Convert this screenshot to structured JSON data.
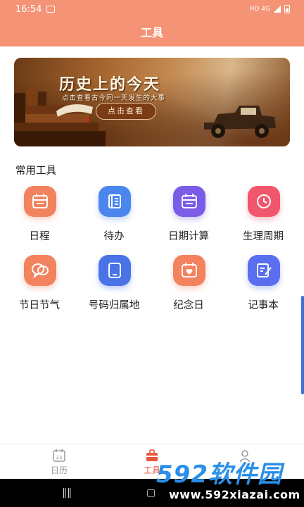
{
  "status_bar": {
    "time": "16:54",
    "network": "HD 4G",
    "signal": "ıll"
  },
  "header": {
    "title": "工具"
  },
  "banner": {
    "title": "历史上的今天",
    "subtitle": "点击查看古今同一天发生的大事",
    "button_label": "点击查看"
  },
  "section": {
    "title": "常用工具"
  },
  "tools": [
    {
      "label": "日程",
      "icon": "calendar-icon",
      "color": "#f3825f"
    },
    {
      "label": "待办",
      "icon": "notebook-icon",
      "color": "#4a86ee"
    },
    {
      "label": "日期计算",
      "icon": "calendar-calc-icon",
      "color": "#7b5ce8"
    },
    {
      "label": "生理周期",
      "icon": "clock-icon",
      "color": "#f0566c"
    },
    {
      "label": "节日节气",
      "icon": "chat-bubbles-icon",
      "color": "#f3825f"
    },
    {
      "label": "号码归属地",
      "icon": "tablet-icon",
      "color": "#4a73e8"
    },
    {
      "label": "纪念日",
      "icon": "heart-calendar-icon",
      "color": "#f3825f"
    },
    {
      "label": "记事本",
      "icon": "note-edit-icon",
      "color": "#5a6ff0"
    }
  ],
  "tabbar": {
    "tabs": [
      {
        "label": "日历",
        "icon": "calendar-tab-icon",
        "badge": "23"
      },
      {
        "label": "工具",
        "icon": "toolbox-tab-icon"
      },
      {
        "label": "",
        "icon": "profile-tab-icon"
      }
    ],
    "active_index": 1
  },
  "watermark": {
    "logo": "592软件园",
    "url": "www.592xiazai.com"
  },
  "colors": {
    "header": "#f49375",
    "accent": "#e5563a"
  }
}
